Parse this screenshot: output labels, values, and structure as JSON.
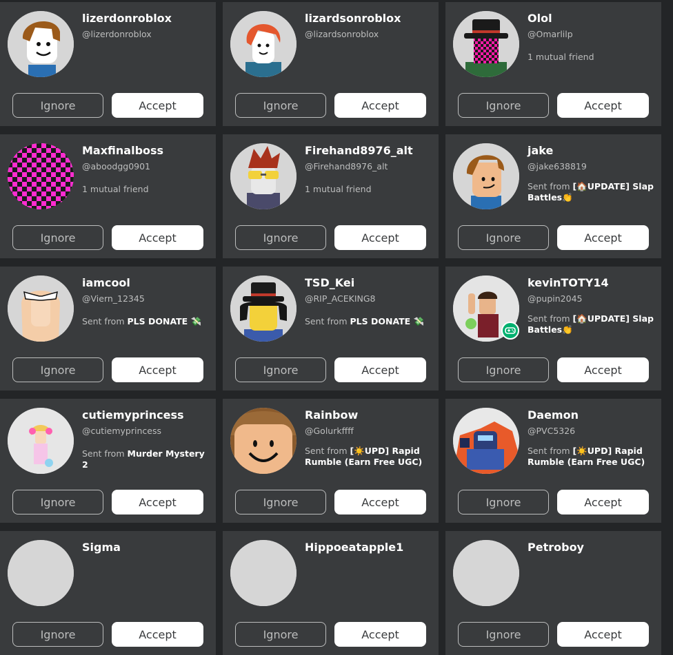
{
  "buttons": {
    "ignore": "Ignore",
    "accept": "Accept"
  },
  "requests": [
    {
      "name": "lizerdonroblox",
      "handle": "@lizerdonroblox",
      "info_prefix": "",
      "info_bold": "",
      "avatar": "classic-brown-hair-avatar"
    },
    {
      "name": "lizardsonroblox",
      "handle": "@lizardsonroblox",
      "info_prefix": "",
      "info_bold": "",
      "avatar": "orange-hair-avatar"
    },
    {
      "name": "Olol",
      "handle": "@Omarlilp",
      "info_prefix": "1 mutual friend",
      "info_bold": "",
      "avatar": "checkered-pink-hat-avatar"
    },
    {
      "name": "Maxfinalboss",
      "handle": "@aboodgg0901",
      "info_prefix": "1 mutual friend",
      "info_bold": "",
      "avatar": "pink-checkered-head-avatar"
    },
    {
      "name": "Firehand8976_alt",
      "handle": "@Firehand8976_alt",
      "info_prefix": "1 mutual friend",
      "info_bold": "",
      "avatar": "sunglasses-red-hair-avatar"
    },
    {
      "name": "jake",
      "handle": "@jake638819",
      "info_prefix": "Sent from ",
      "info_bold": "[🏠UPDATE] Slap Battles👏",
      "avatar": "smirk-brown-hair-avatar"
    },
    {
      "name": "iamcool",
      "handle": "@Viern_12345",
      "info_prefix": "Sent from ",
      "info_bold": "PLS DONATE 💸",
      "avatar": "blonde-white-glasses-avatar"
    },
    {
      "name": "TSD_Kei",
      "handle": "@RIP_ACEKING8",
      "info_prefix": "Sent from ",
      "info_bold": "PLS DONATE 💸",
      "avatar": "black-hat-yellow-avatar"
    },
    {
      "name": "kevinTOTY14",
      "handle": "@pupin2045",
      "info_prefix": "Sent from ",
      "info_bold": "[🏠UPDATE] Slap Battles👏",
      "avatar": "waving-avatar",
      "badge": "gamepad-icon"
    },
    {
      "name": "cutiemyprincess",
      "handle": "@cutiemyprincess",
      "info_prefix": "Sent from ",
      "info_bold": "Murder Mystery 2",
      "avatar": "pink-bunny-avatar"
    },
    {
      "name": "Rainbow",
      "handle": "@Golurkffff",
      "info_prefix": "Sent from ",
      "info_bold": "[☀️UPD] Rapid Rumble (Earn Free UGC)",
      "avatar": "smile-face-avatar"
    },
    {
      "name": "Daemon",
      "handle": "@PVC5326",
      "info_prefix": "Sent from ",
      "info_bold": "[☀️UPD] Rapid Rumble (Earn Free UGC)",
      "avatar": "robot-fighter-avatar"
    },
    {
      "name": "Sigma",
      "handle": "",
      "info_prefix": "",
      "info_bold": "",
      "avatar": "avatar"
    },
    {
      "name": "Hippoeatapple1",
      "handle": "",
      "info_prefix": "",
      "info_bold": "",
      "avatar": "avatar"
    },
    {
      "name": "Petroboy",
      "handle": "",
      "info_prefix": "",
      "info_bold": "",
      "avatar": "avatar"
    }
  ]
}
